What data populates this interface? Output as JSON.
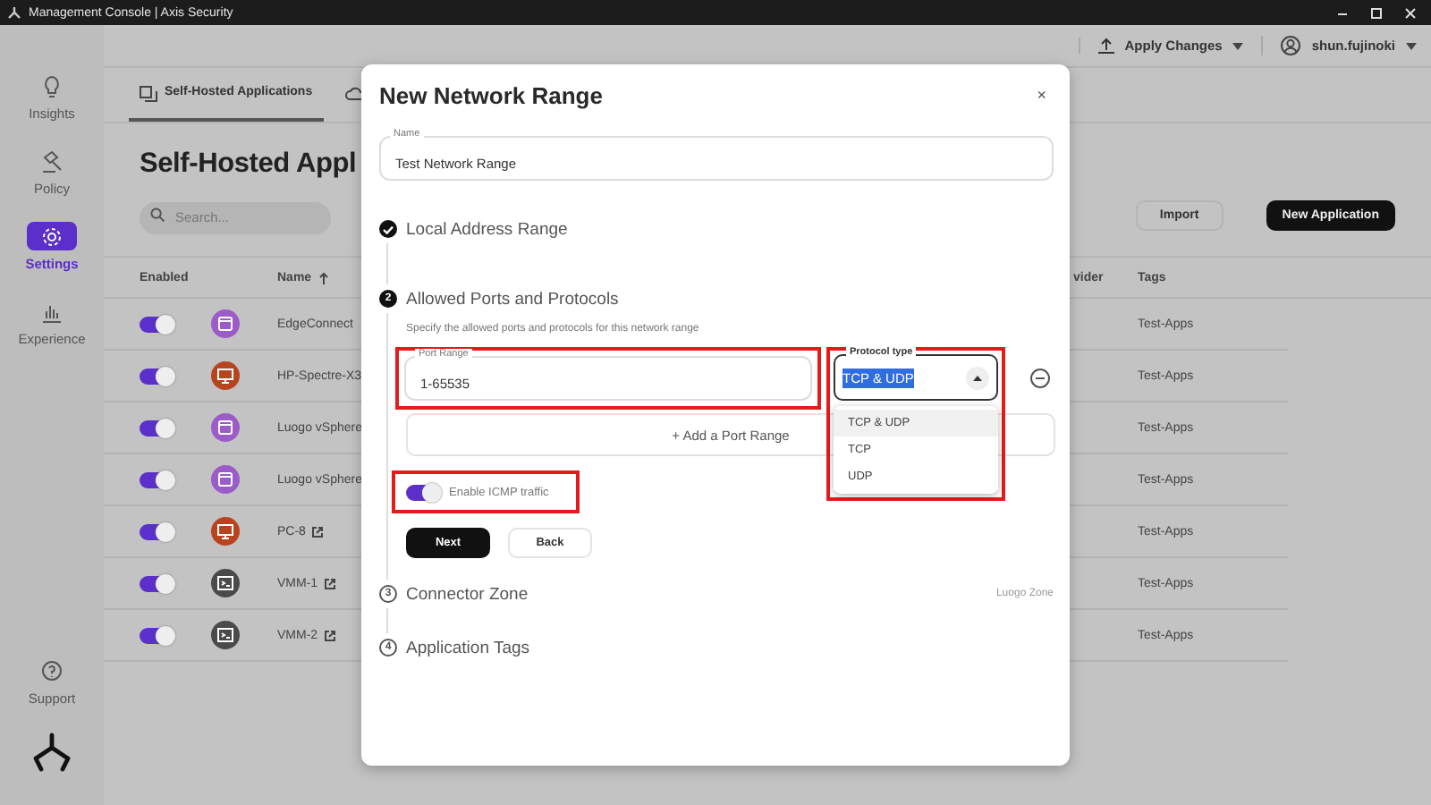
{
  "window": {
    "title": "Management Console | Axis Security"
  },
  "header": {
    "apply_label": "Apply Changes",
    "user": "shun.fujinoki"
  },
  "sidebar": {
    "items": [
      {
        "label": "Insights",
        "selected": false
      },
      {
        "label": "Policy",
        "selected": false
      },
      {
        "label": "Settings",
        "selected": true
      },
      {
        "label": "Experience",
        "selected": false
      }
    ],
    "footer": {
      "label": "Support"
    }
  },
  "tabs": [
    {
      "label": "Self-Hosted Applications",
      "selected": true
    },
    {
      "selected": false
    }
  ],
  "page_title": "Self-Hosted Appl",
  "search": {
    "placeholder": "Search..."
  },
  "buttons": [
    {
      "label": "Import",
      "kind": "secondary"
    },
    {
      "label": "New Application",
      "kind": "primary"
    }
  ],
  "table": {
    "columns": [
      "Enabled",
      "Name",
      "vider",
      "Tags"
    ],
    "rows": [
      {
        "enabled": true,
        "kind": "app",
        "color": "#9b5bc9",
        "name": "EdgeConnect",
        "external": false,
        "tags": "Test-Apps"
      },
      {
        "enabled": true,
        "kind": "desktop",
        "color": "#b8431f",
        "name": "HP-Spectre-X3",
        "external": false,
        "tags": "Test-Apps"
      },
      {
        "enabled": true,
        "kind": "app",
        "color": "#9b5bc9",
        "name": "Luogo vSphere",
        "external": false,
        "tags": "Test-Apps"
      },
      {
        "enabled": true,
        "kind": "app",
        "color": "#9b5bc9",
        "name": "Luogo vSphere",
        "external": false,
        "tags": "Test-Apps"
      },
      {
        "enabled": true,
        "kind": "desktop",
        "color": "#b8431f",
        "name": "PC-8",
        "external": true,
        "tags": "Test-Apps"
      },
      {
        "enabled": true,
        "kind": "terminal",
        "color": "#4a4a4a",
        "name": "VMM-1",
        "external": true,
        "tags": "Test-Apps"
      },
      {
        "enabled": true,
        "kind": "terminal",
        "color": "#4a4a4a",
        "name": "VMM-2",
        "external": true,
        "tags": "Test-Apps"
      }
    ]
  },
  "dialog": {
    "title": "New Network Range",
    "close": "×",
    "name_field": {
      "label": "Name",
      "value": "Test Network Range"
    },
    "steps": [
      {
        "title": "Local Address Range",
        "completed": true,
        "active": false
      },
      {
        "number": "2",
        "title": "Allowed Ports and Protocols",
        "completed": false,
        "active": true,
        "description": "Specify the allowed ports and protocols for this network range",
        "port_range": {
          "label": "Port Range",
          "value": "1-65535",
          "highlighted": true
        },
        "protocol": {
          "label": "Protocol type",
          "value": "TCP & UDP",
          "highlighted": true,
          "expanded": true,
          "options": [
            {
              "label": "TCP & UDP",
              "selected": true
            },
            {
              "label": "TCP",
              "selected": false
            },
            {
              "label": "UDP",
              "selected": false
            }
          ]
        },
        "add_label": "+ Add a Port Range",
        "icmp": {
          "label": "Enable ICMP traffic",
          "on": true,
          "highlighted": true
        },
        "next": "Next",
        "back": "Back"
      },
      {
        "number": "3",
        "title": "Connector Zone",
        "completed": false,
        "active": false,
        "value": "Luogo Zone"
      },
      {
        "number": "4",
        "title": "Application Tags",
        "completed": false,
        "active": false
      }
    ]
  }
}
